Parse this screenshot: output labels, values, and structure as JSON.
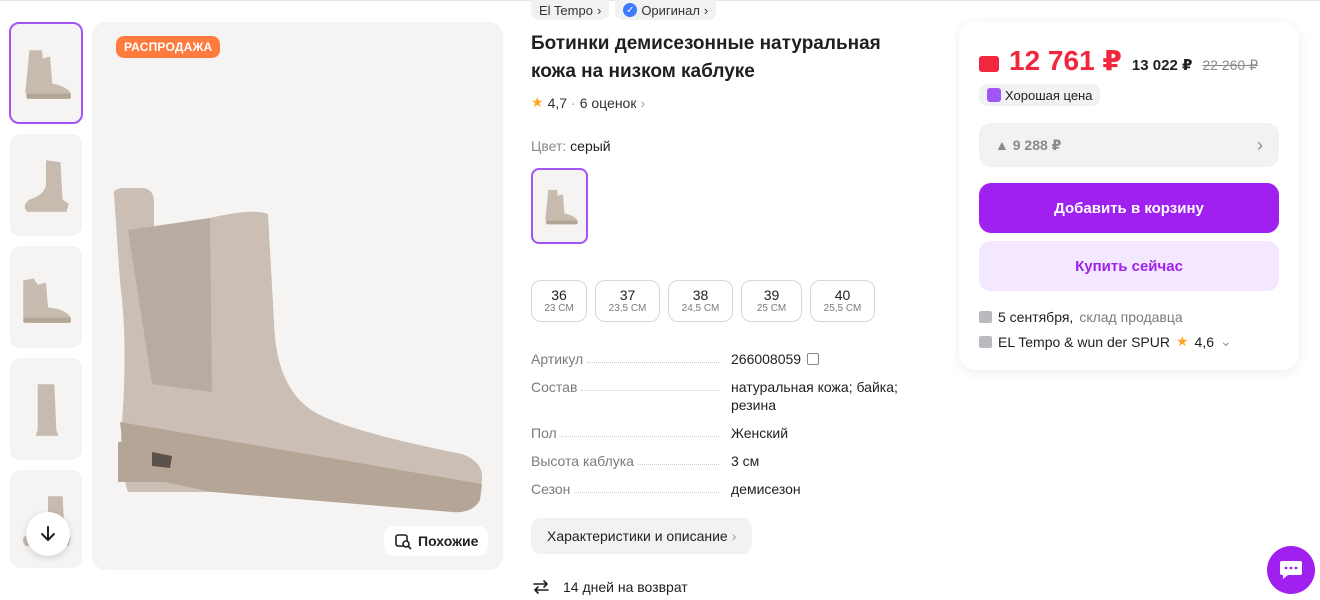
{
  "brand_chips": {
    "brand": "El Tempo",
    "original": "Оригинал"
  },
  "product": {
    "title": "Ботинки демисезонные натуральная кожа на низком каблуке",
    "rating": "4,7",
    "reviews": "6 оценок",
    "color_label": "Цвет:",
    "color_value": "серый"
  },
  "gallery": {
    "sale_badge": "РАСПРОДАЖА",
    "similar_label": "Похожие"
  },
  "sizes": [
    {
      "n": "36",
      "c": "23 СМ"
    },
    {
      "n": "37",
      "c": "23,5 СМ"
    },
    {
      "n": "38",
      "c": "24,5 СМ"
    },
    {
      "n": "39",
      "c": "25 СМ"
    },
    {
      "n": "40",
      "c": "25,5 СМ"
    }
  ],
  "specs": [
    {
      "k": "Артикул",
      "v": "266008059"
    },
    {
      "k": "Состав",
      "v": "натуральная кожа; байка; резина"
    },
    {
      "k": "Пол",
      "v": "Женский"
    },
    {
      "k": "Высота каблука",
      "v": "3 см"
    },
    {
      "k": "Сезон",
      "v": "демисезон"
    }
  ],
  "desc_button": "Характеристики и описание",
  "return_text": "14 дней на возврат",
  "card": {
    "price_wallet": "12 761 ₽",
    "price_regular": "13 022 ₽",
    "price_old": "22 260 ₽",
    "good_price": "Хорошая цена",
    "installment": "▲ 9 288 ₽",
    "add_to_cart": "Добавить в корзину",
    "buy_now": "Купить сейчас",
    "delivery_date": "5 сентября,",
    "delivery_from": "склад продавца",
    "seller_name": "EL Tempo & wun der SPUR",
    "seller_rating": "4,6"
  },
  "colors": {
    "accent": "#a020f0",
    "price": "#f2273d",
    "badge": "#ff7a3d"
  }
}
